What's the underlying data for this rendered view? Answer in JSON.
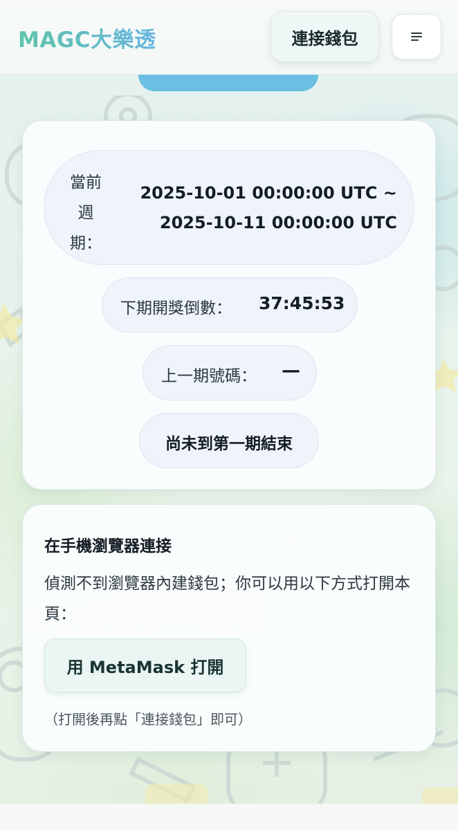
{
  "header": {
    "logo": "MAGC大樂透",
    "connect_wallet_label": "連接錢包",
    "menu_icon": "hamburger-menu-icon"
  },
  "lottery": {
    "current_period_label": "當前週期：",
    "current_period_label_chars": [
      "當前",
      "週",
      "期："
    ],
    "current_period_start": "2025-10-01 00:00:00 UTC ~",
    "current_period_end": "2025-10-11 00:00:00 UTC",
    "countdown_label": "下期開獎倒數：",
    "countdown_value": "37:45:53",
    "last_numbers_label": "上一期號碼：",
    "last_numbers_value": "—",
    "status_text": "尚未到第一期結束"
  },
  "mobile_connect": {
    "title": "在手機瀏覽器連接",
    "description": "偵測不到瀏覽器內建錢包；你可以用以下方式打開本頁：",
    "metamask_button_label": "用 MetaMask 打開",
    "hint": "（打開後再點「連接錢包」即可）"
  },
  "colors": {
    "logo_gradient_start": "#5fc4a8",
    "logo_gradient_end": "#66b4e0",
    "background": "#e8f3f0"
  }
}
